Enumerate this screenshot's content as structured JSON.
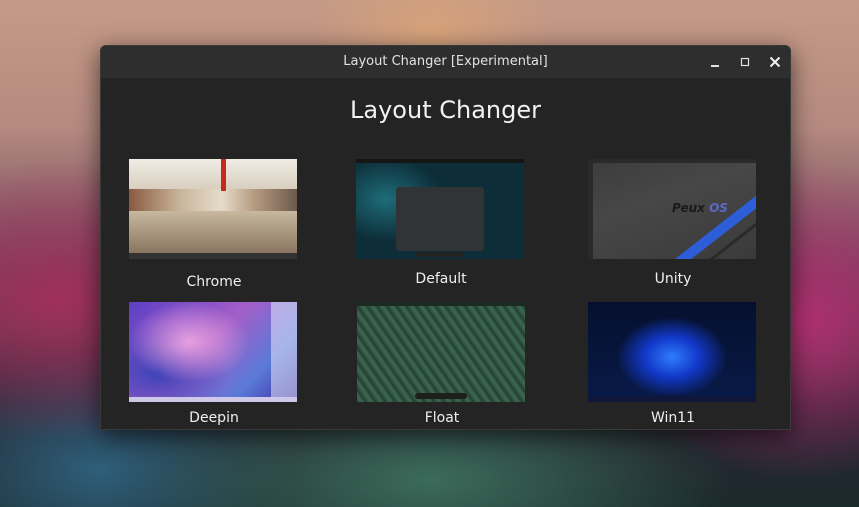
{
  "window": {
    "title": "Layout Changer [Experimental]",
    "controls": {
      "minimize": "minimize-icon",
      "maximize": "maximize-icon",
      "close": "close-icon"
    }
  },
  "main": {
    "heading": "Layout Changer",
    "layouts": [
      {
        "label": "Chrome"
      },
      {
        "label": "Default"
      },
      {
        "label": "Unity",
        "thumbnail_text": "Peux OS"
      },
      {
        "label": "Deepin"
      },
      {
        "label": "Float"
      },
      {
        "label": "Win11"
      }
    ]
  },
  "colors": {
    "window_bg": "#242424",
    "titlebar_bg": "#2e2e2e",
    "text": "#f0f0f0",
    "peux_accent": "#5c68c8"
  }
}
